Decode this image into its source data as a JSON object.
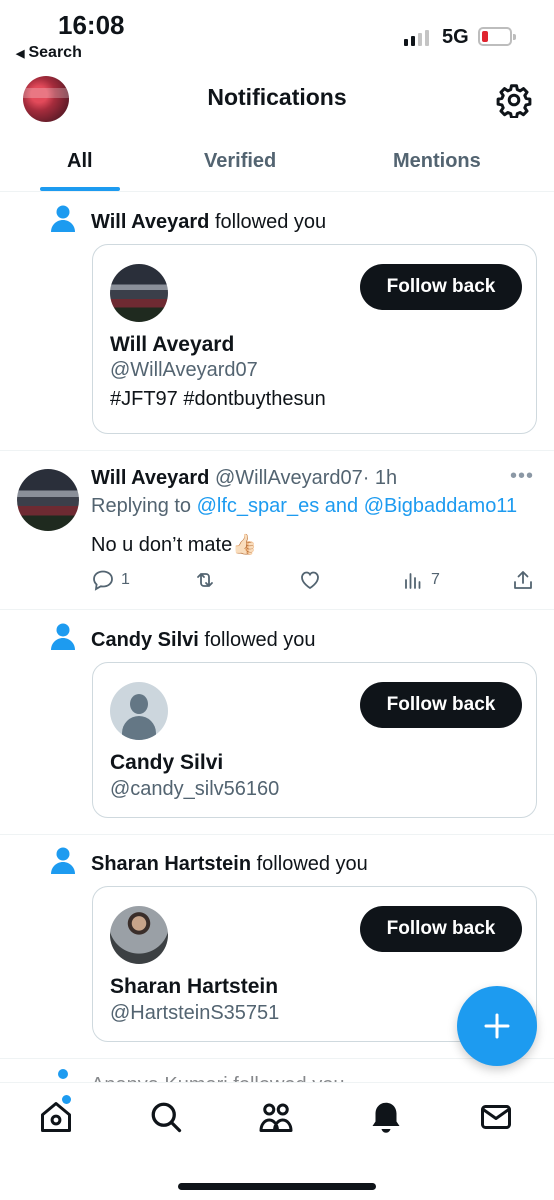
{
  "status_bar": {
    "time": "16:08",
    "back_label": "Search",
    "network": "5G",
    "battery_level": 0.15,
    "battery_color": "#e0242f"
  },
  "header": {
    "title": "Notifications",
    "avatar_icon": "profile-avatar",
    "settings_icon": "gear-icon"
  },
  "tabs": [
    {
      "label": "All",
      "active": true
    },
    {
      "label": "Verified",
      "active": false
    },
    {
      "label": "Mentions",
      "active": false
    }
  ],
  "notifications": [
    {
      "name": "Will Aveyard",
      "action": "followed you",
      "card": {
        "name": "Will Aveyard",
        "handle": "@WillAveyard07",
        "bio": "#JFT97 #dontbuythesun",
        "button": "Follow back"
      }
    },
    {
      "name": "Candy Silvi",
      "action": "followed you",
      "card": {
        "name": "Candy Silvi",
        "handle": "@candy_silv56160",
        "bio": "",
        "button": "Follow back"
      }
    },
    {
      "name": "Sharan Hartstein",
      "action": "followed you",
      "card": {
        "name": "Sharan Hartstein",
        "handle": "@HartsteinS35751",
        "bio": "",
        "button": "Follow back"
      }
    }
  ],
  "tweet": {
    "name": "Will Aveyard",
    "handle": "@WillAveyard07",
    "time": "· 1h",
    "more": "•••",
    "replying_prefix": "Replying to",
    "mention1": "@lfc_spar_es",
    "and": "and",
    "mention2": "@Bigbaddamo11",
    "text": "No u don’t mate👍🏻",
    "reply_count": "1",
    "retweet_count": "",
    "like_count": "",
    "view_count": "7"
  },
  "partial_row_text": "Ananya Kumari followed you",
  "colors": {
    "accent": "#1d9bf0",
    "text": "#0f1419",
    "muted": "#536471",
    "button_bg": "#0f1419"
  },
  "bottom_nav": [
    "home-icon",
    "search-icon",
    "communities-icon",
    "notifications-bell-icon",
    "messages-icon"
  ]
}
